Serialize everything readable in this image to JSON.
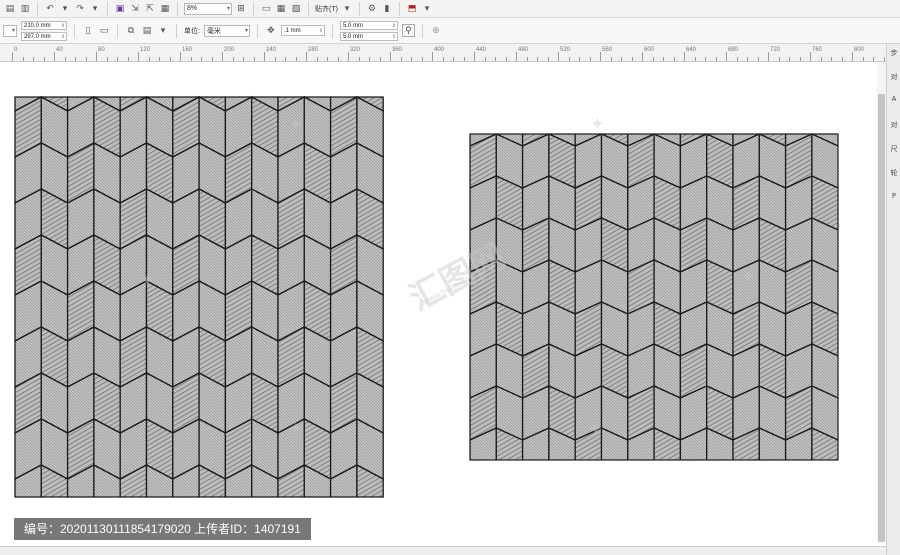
{
  "toolbar": {
    "zoom_value": "8%",
    "snap_label": "贴齐(T)",
    "page_width": "210.0 mm",
    "page_height": "297.0 mm",
    "units_label": "单位:",
    "units_value": "毫米",
    "nudge_value": ".1 mm",
    "dup_x": "5.0 mm",
    "dup_y": "5.0 mm"
  },
  "ruler": {
    "labels": [
      "0",
      "40",
      "80",
      "120",
      "160",
      "200",
      "240",
      "280",
      "320",
      "360",
      "400",
      "440",
      "480",
      "520",
      "560",
      "600",
      "640",
      "680",
      "720",
      "760",
      "800"
    ]
  },
  "docker": {
    "labels": [
      "步",
      "对",
      "A",
      "对",
      "尺",
      "轮",
      "ℙ"
    ]
  },
  "watermark": {
    "brand": "汇图网",
    "url": "www.huitu.com"
  },
  "info": {
    "text": "编号：20201130111854179020 上传者ID：1407191"
  }
}
